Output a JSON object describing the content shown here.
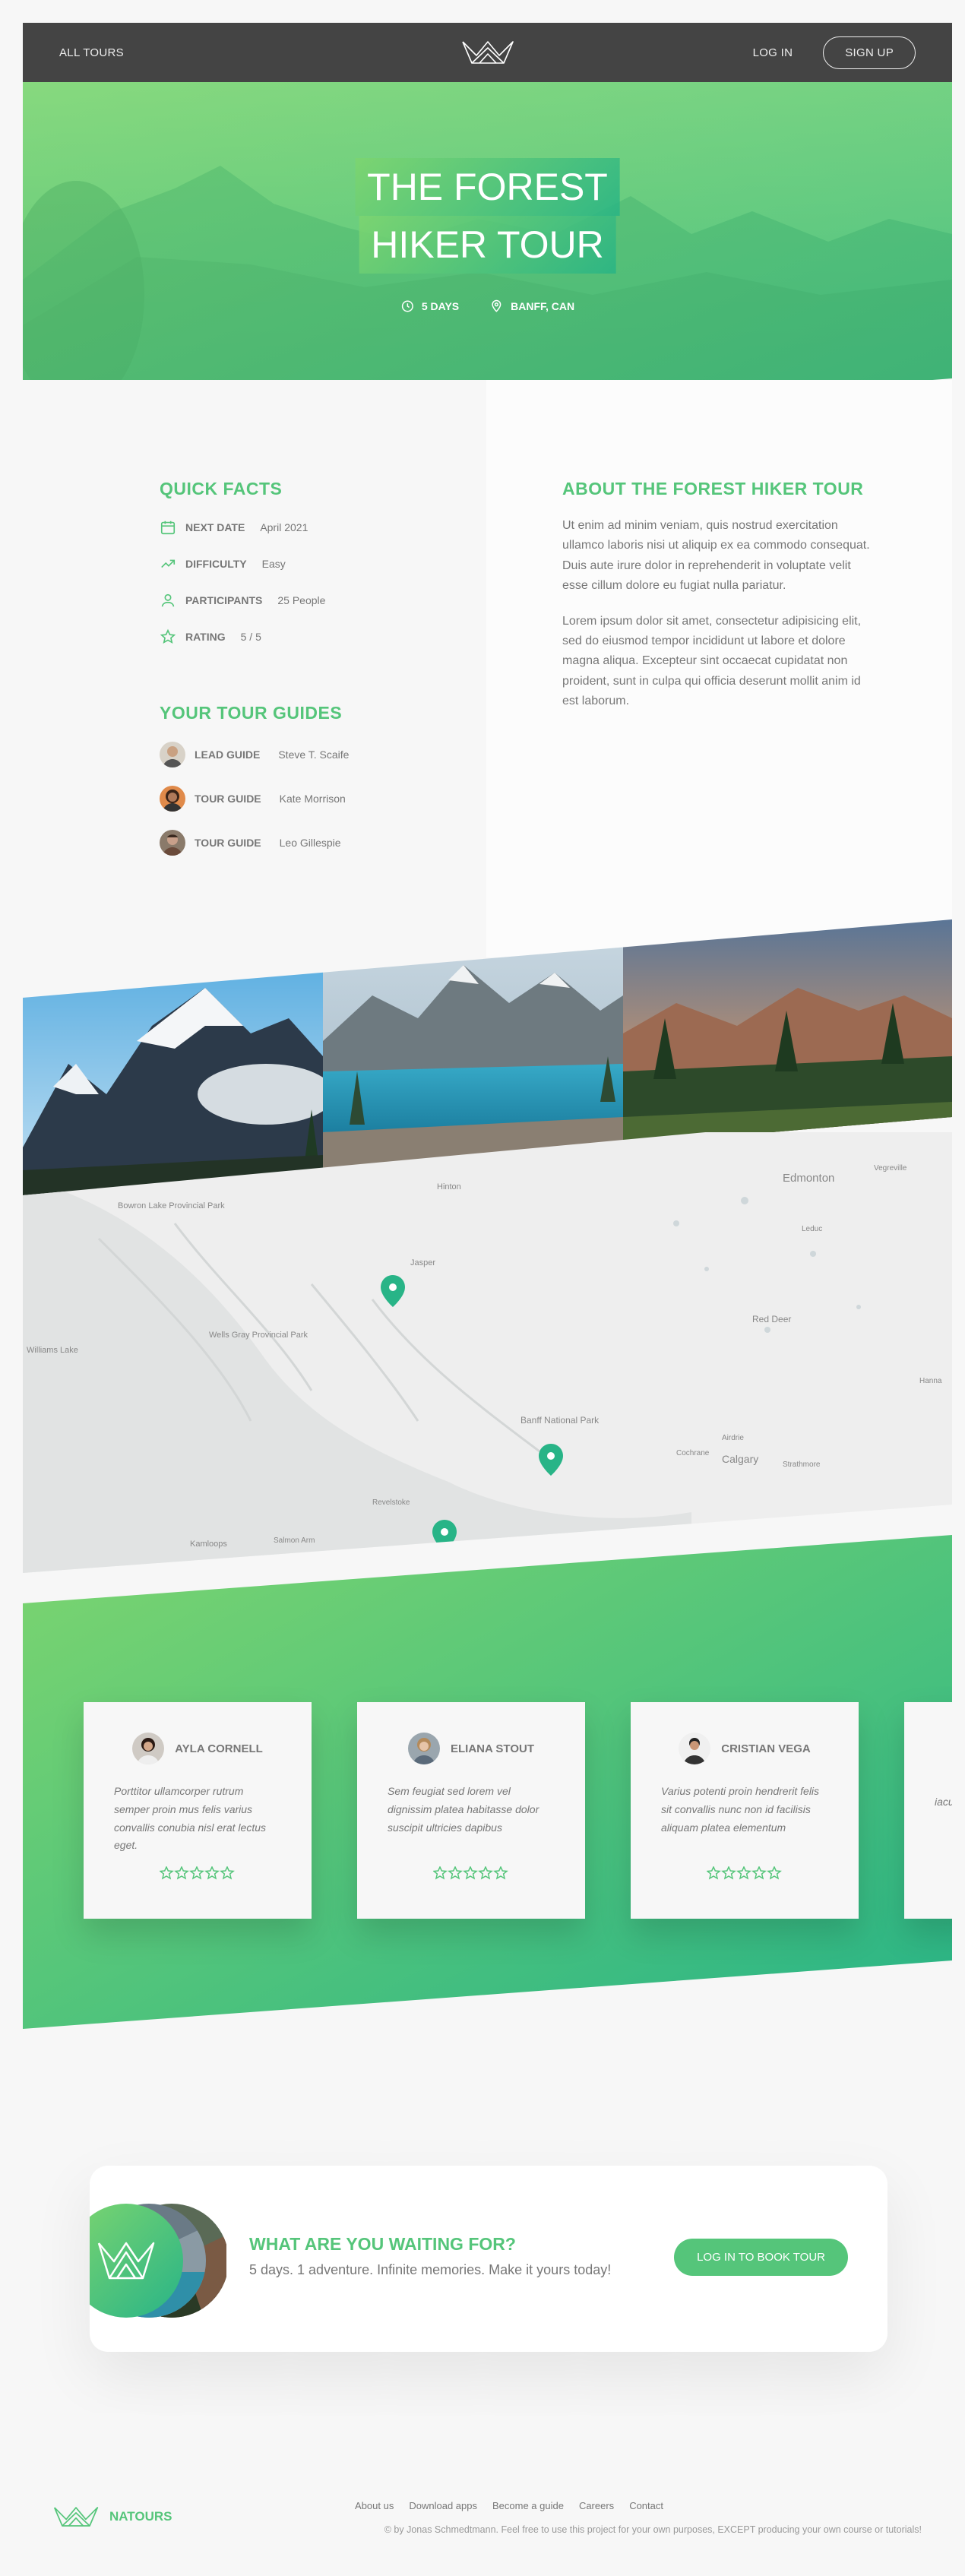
{
  "header": {
    "all_tours": "All tours",
    "log_in": "Log in",
    "sign_up": "Sign up"
  },
  "hero": {
    "title_line1": "The Forest",
    "title_line2": "Hiker Tour",
    "duration": "5 days",
    "location": "Banff, CAN"
  },
  "quick_facts": {
    "heading": "Quick facts",
    "items": [
      {
        "label": "Next date",
        "text": "April 2021",
        "icon": "calendar-icon"
      },
      {
        "label": "Difficulty",
        "text": "Easy",
        "icon": "trending-up-icon"
      },
      {
        "label": "Participants",
        "text": "25 People",
        "icon": "user-icon"
      },
      {
        "label": "Rating",
        "text": "5 / 5",
        "icon": "star-icon"
      }
    ]
  },
  "guides": {
    "heading": "Your tour guides",
    "items": [
      {
        "label": "Lead guide",
        "name": "Steve T. Scaife"
      },
      {
        "label": "Tour guide",
        "name": "Kate Morrison"
      },
      {
        "label": "Tour guide",
        "name": "Leo Gillespie"
      }
    ]
  },
  "about": {
    "heading": "About the forest hiker tour",
    "para1": "Ut enim ad minim veniam, quis nostrud exercitation ullamco laboris nisi ut aliquip ex ea commodo consequat. Duis aute irure dolor in reprehenderit in voluptate velit esse cillum dolore eu fugiat nulla pariatur.",
    "para2": "Lorem ipsum dolor sit amet, consectetur adipisicing elit, sed do eiusmod tempor incididunt ut labore et dolore magna aliqua. Excepteur sint occaecat cupidatat non proident, sunt in culpa qui officia deserunt mollit anim id est laborum."
  },
  "map": {
    "labels": [
      "Edmonton",
      "Red Deer",
      "Banff National Park",
      "Calgary",
      "Jasper",
      "Williams Lake",
      "Kamloops",
      "Wells Gray Provincial Park",
      "Hinton",
      "Cochrane",
      "Airdrie",
      "Strathmore",
      "Vegreville",
      "Hanna",
      "Revelstoke",
      "Salmon Arm",
      "Leduc",
      "Bowron Lake Provincial Park"
    ]
  },
  "reviews": [
    {
      "name": "Ayla Cornell",
      "text": "Porttitor ullamcorper rutrum semper proin mus felis varius convallis conubia nisl erat lectus eget.",
      "rating": 5
    },
    {
      "name": "Eliana Stout",
      "text": "Sem feugiat sed lorem vel dignissim platea habitasse dolor suscipit ultricies dapibus",
      "rating": 5
    },
    {
      "name": "Cristian Vega",
      "text": "Varius potenti proin hendrerit felis sit convallis nunc non id facilisis aliquam platea elementum",
      "rating": 5
    },
    {
      "name": "",
      "text": "iacu rhon susp pelle",
      "rating": 0
    }
  ],
  "cta": {
    "title": "What are you waiting for?",
    "subtitle": "5 days. 1 adventure. Infinite memories. Make it yours today!",
    "button": "Log in to book tour"
  },
  "footer": {
    "logo_text": "Natours",
    "links": [
      "About us",
      "Download apps",
      "Become a guide",
      "Careers",
      "Contact"
    ],
    "copyright": "© by Jonas Schmedtmann. Feel free to use this project for your own purposes, EXCEPT producing your own course or tutorials!"
  },
  "colors": {
    "brand_light": "#7dd56f",
    "brand_dark": "#28b487",
    "green": "#55c57a",
    "header": "#444444"
  }
}
